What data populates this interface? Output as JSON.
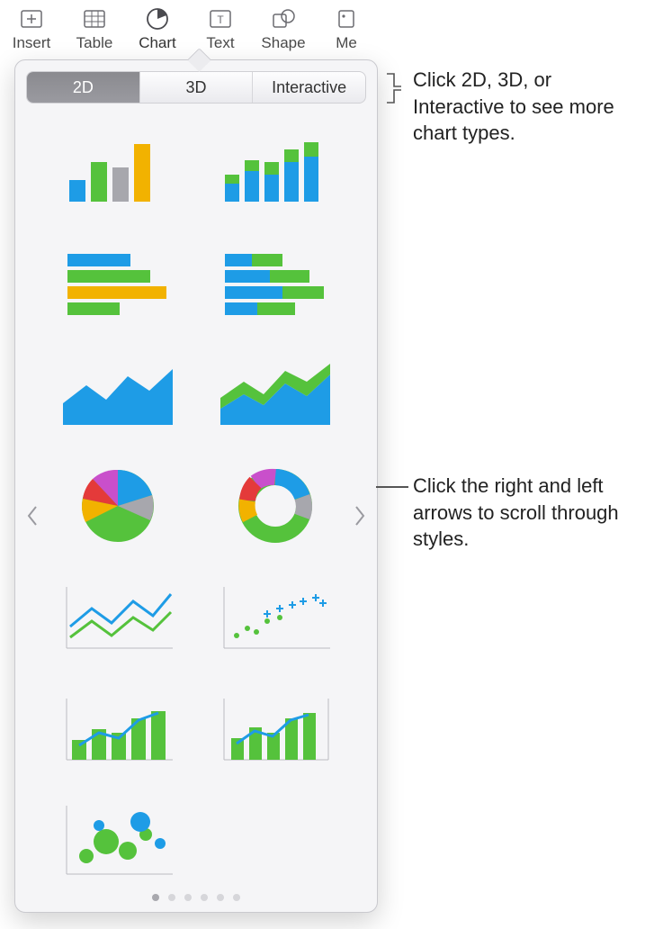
{
  "toolbar": {
    "items": [
      {
        "id": "insert",
        "label": "Insert"
      },
      {
        "id": "table",
        "label": "Table"
      },
      {
        "id": "chart",
        "label": "Chart",
        "active": true
      },
      {
        "id": "text",
        "label": "Text"
      },
      {
        "id": "shape",
        "label": "Shape"
      },
      {
        "id": "media",
        "label": "Me"
      }
    ]
  },
  "popover": {
    "tabs": [
      {
        "label": "2D",
        "active": true
      },
      {
        "label": "3D"
      },
      {
        "label": "Interactive"
      }
    ],
    "chart_types": [
      {
        "name": "column-chart"
      },
      {
        "name": "stacked-column-chart"
      },
      {
        "name": "bar-chart"
      },
      {
        "name": "stacked-bar-chart"
      },
      {
        "name": "area-chart"
      },
      {
        "name": "stacked-area-chart"
      },
      {
        "name": "pie-chart"
      },
      {
        "name": "donut-chart"
      },
      {
        "name": "line-chart"
      },
      {
        "name": "scatter-chart"
      },
      {
        "name": "mixed-bar-line-chart"
      },
      {
        "name": "two-axis-chart"
      },
      {
        "name": "bubble-chart"
      }
    ],
    "page_dots": {
      "count": 6,
      "active_index": 0
    }
  },
  "palette": {
    "blue": "#1E9CE6",
    "green": "#55C23C",
    "yellow": "#F2B200",
    "gray": "#A7A7AD",
    "red": "#E43A3A",
    "purple": "#C94FCB"
  },
  "callouts": {
    "tabs": "Click 2D, 3D, or Interactive to see more chart types.",
    "arrows": "Click the right and left arrows to scroll through styles."
  }
}
